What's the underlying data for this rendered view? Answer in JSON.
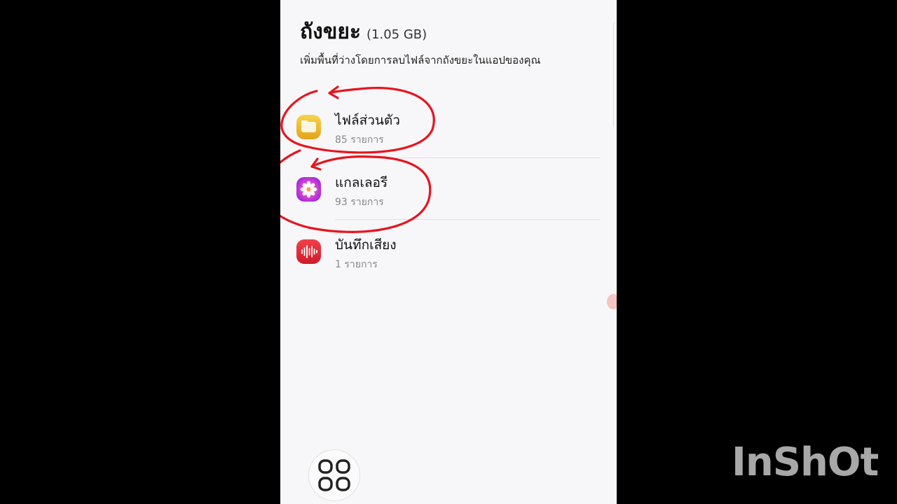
{
  "header": {
    "title": "ถังขยะ",
    "size": "(1.05 GB)",
    "subtitle": "เพิ่มพื้นที่ว่างโดยการลบไฟล์จากถังขยะในแอปของคุณ"
  },
  "items": [
    {
      "label": "ไฟล์ส่วนตัว",
      "count": "85 รายการ",
      "icon": "my-files-icon",
      "color": "#f2bd2f"
    },
    {
      "label": "แกลเลอรี",
      "count": "93 รายการ",
      "icon": "gallery-icon",
      "color": "#c73bd6"
    },
    {
      "label": "บันทึกเสียง",
      "count": "1 รายการ",
      "icon": "voice-recorder-icon",
      "color": "#e62a36"
    }
  ],
  "annotation_color": "#e8141e",
  "watermark": "InShOt"
}
